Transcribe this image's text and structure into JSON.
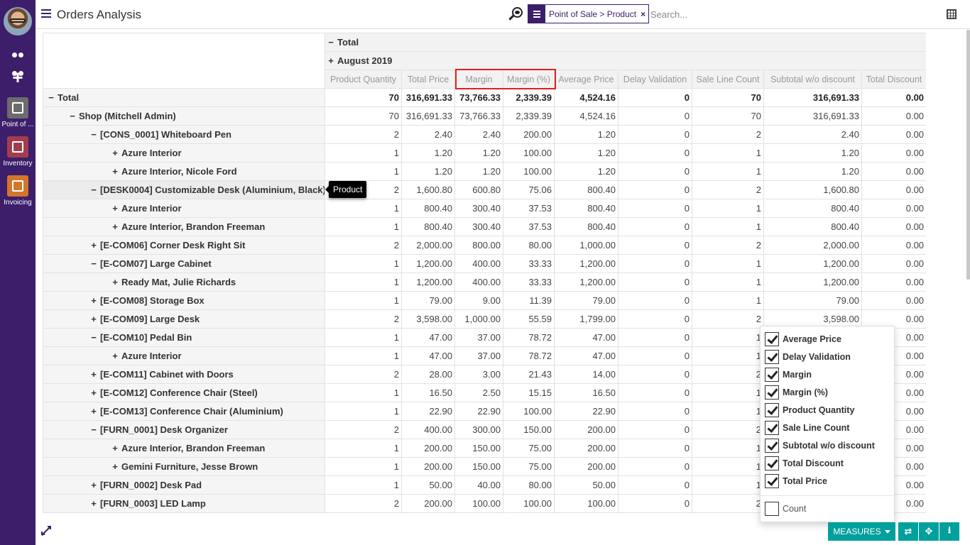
{
  "appbar": {
    "apps": [
      {
        "label": "Point of ...",
        "icon": "point-of-sale-icon"
      },
      {
        "label": "Inventory",
        "icon": "inventory-icon"
      },
      {
        "label": "Invoicing",
        "icon": "invoicing-icon"
      }
    ]
  },
  "header": {
    "title": "Orders Analysis",
    "facet": "Point of Sale > Product",
    "facet_remove": "×",
    "search_placeholder": "Search..."
  },
  "pivot": {
    "col_total": "Total",
    "col_group": "August 2019",
    "measures": [
      "Product Quantity",
      "Total Price",
      "Margin",
      "Margin (%)",
      "Average Price",
      "Delay Validation",
      "Sale Line Count",
      "Subtotal w/o discount",
      "Total Discount"
    ],
    "rows": [
      {
        "sign": "−",
        "level": 0,
        "label": "Total",
        "values": [
          "70",
          "316,691.33",
          "73,766.33",
          "2,339.39",
          "4,524.16",
          "0",
          "70",
          "316,691.33",
          "0.00"
        ]
      },
      {
        "sign": "−",
        "level": 1,
        "label": "Shop (Mitchell Admin)",
        "values": [
          "70",
          "316,691.33",
          "73,766.33",
          "2,339.39",
          "4,524.16",
          "0",
          "70",
          "316,691.33",
          "0.00"
        ]
      },
      {
        "sign": "−",
        "level": 2,
        "label": "[CONS_0001] Whiteboard Pen",
        "values": [
          "2",
          "2.40",
          "2.40",
          "200.00",
          "1.20",
          "0",
          "2",
          "2.40",
          "0.00"
        ]
      },
      {
        "sign": "+",
        "level": 3,
        "label": "Azure Interior",
        "values": [
          "1",
          "1.20",
          "1.20",
          "100.00",
          "1.20",
          "0",
          "1",
          "1.20",
          "0.00"
        ]
      },
      {
        "sign": "+",
        "level": 3,
        "label": "Azure Interior, Nicole Ford",
        "values": [
          "1",
          "1.20",
          "1.20",
          "100.00",
          "1.20",
          "0",
          "1",
          "1.20",
          "0.00"
        ]
      },
      {
        "sign": "−",
        "level": 2,
        "label": "[DESK0004] Customizable Desk (Aluminium, Black)",
        "values": [
          "2",
          "1,600.80",
          "600.80",
          "75.06",
          "800.40",
          "0",
          "2",
          "1,600.80",
          "0.00"
        ]
      },
      {
        "sign": "+",
        "level": 3,
        "label": "Azure Interior",
        "values": [
          "1",
          "800.40",
          "300.40",
          "37.53",
          "800.40",
          "0",
          "1",
          "800.40",
          "0.00"
        ]
      },
      {
        "sign": "+",
        "level": 3,
        "label": "Azure Interior, Brandon Freeman",
        "values": [
          "1",
          "800.40",
          "300.40",
          "37.53",
          "800.40",
          "0",
          "1",
          "800.40",
          "0.00"
        ]
      },
      {
        "sign": "+",
        "level": 2,
        "label": "[E-COM06] Corner Desk Right Sit",
        "values": [
          "2",
          "2,000.00",
          "800.00",
          "80.00",
          "1,000.00",
          "0",
          "2",
          "2,000.00",
          "0.00"
        ]
      },
      {
        "sign": "−",
        "level": 2,
        "label": "[E-COM07] Large Cabinet",
        "values": [
          "1",
          "1,200.00",
          "400.00",
          "33.33",
          "1,200.00",
          "0",
          "1",
          "1,200.00",
          "0.00"
        ]
      },
      {
        "sign": "+",
        "level": 3,
        "label": "Ready Mat, Julie Richards",
        "values": [
          "1",
          "1,200.00",
          "400.00",
          "33.33",
          "1,200.00",
          "0",
          "1",
          "1,200.00",
          "0.00"
        ]
      },
      {
        "sign": "+",
        "level": 2,
        "label": "[E-COM08] Storage Box",
        "values": [
          "1",
          "79.00",
          "9.00",
          "11.39",
          "79.00",
          "0",
          "1",
          "79.00",
          "0.00"
        ]
      },
      {
        "sign": "+",
        "level": 2,
        "label": "[E-COM09] Large Desk",
        "values": [
          "2",
          "3,598.00",
          "1,000.00",
          "55.59",
          "1,799.00",
          "0",
          "2",
          "3,598.00",
          "0.00"
        ]
      },
      {
        "sign": "−",
        "level": 2,
        "label": "[E-COM10] Pedal Bin",
        "values": [
          "1",
          "47.00",
          "37.00",
          "78.72",
          "47.00",
          "0",
          "1",
          "",
          "0.00"
        ]
      },
      {
        "sign": "+",
        "level": 3,
        "label": "Azure Interior",
        "values": [
          "1",
          "47.00",
          "37.00",
          "78.72",
          "47.00",
          "0",
          "1",
          "",
          "0.00"
        ]
      },
      {
        "sign": "+",
        "level": 2,
        "label": "[E-COM11] Cabinet with Doors",
        "values": [
          "2",
          "28.00",
          "3.00",
          "21.43",
          "14.00",
          "0",
          "2",
          "",
          "0.00"
        ]
      },
      {
        "sign": "+",
        "level": 2,
        "label": "[E-COM12] Conference Chair (Steel)",
        "values": [
          "1",
          "16.50",
          "2.50",
          "15.15",
          "16.50",
          "0",
          "1",
          "",
          "0.00"
        ]
      },
      {
        "sign": "+",
        "level": 2,
        "label": "[E-COM13] Conference Chair (Aluminium)",
        "values": [
          "1",
          "22.90",
          "22.90",
          "100.00",
          "22.90",
          "0",
          "1",
          "",
          "0.00"
        ]
      },
      {
        "sign": "−",
        "level": 2,
        "label": "[FURN_0001] Desk Organizer",
        "values": [
          "2",
          "400.00",
          "300.00",
          "150.00",
          "200.00",
          "0",
          "2",
          "",
          "0.00"
        ]
      },
      {
        "sign": "+",
        "level": 3,
        "label": "Azure Interior, Brandon Freeman",
        "values": [
          "1",
          "200.00",
          "150.00",
          "75.00",
          "200.00",
          "0",
          "1",
          "",
          "0.00"
        ]
      },
      {
        "sign": "+",
        "level": 3,
        "label": "Gemini Furniture, Jesse Brown",
        "values": [
          "1",
          "200.00",
          "150.00",
          "75.00",
          "200.00",
          "0",
          "1",
          "",
          "0.00"
        ]
      },
      {
        "sign": "+",
        "level": 2,
        "label": "[FURN_0002] Desk Pad",
        "values": [
          "1",
          "50.00",
          "40.00",
          "80.00",
          "50.00",
          "0",
          "1",
          "",
          "0.00"
        ]
      },
      {
        "sign": "+",
        "level": 2,
        "label": "[FURN_0003] LED Lamp",
        "values": [
          "2",
          "200.00",
          "100.00",
          "100.00",
          "100.00",
          "0",
          "2",
          "",
          "0.00"
        ]
      }
    ]
  },
  "tooltip": "Product",
  "measures_menu": {
    "items": [
      {
        "label": "Average Price",
        "checked": true
      },
      {
        "label": "Delay Validation",
        "checked": true
      },
      {
        "label": "Margin",
        "checked": true
      },
      {
        "label": "Margin (%)",
        "checked": true
      },
      {
        "label": "Product Quantity",
        "checked": true
      },
      {
        "label": "Sale Line Count",
        "checked": true
      },
      {
        "label": "Subtotal w/o discount",
        "checked": true
      },
      {
        "label": "Total Discount",
        "checked": true
      },
      {
        "label": "Total Price",
        "checked": true
      }
    ],
    "count_label": "Count",
    "count_checked": false
  },
  "bottom": {
    "measures_label": "MEASURES",
    "flip_icon": "flip-axis-icon",
    "expand_icon": "expand-all-icon",
    "download_icon": "download-icon"
  },
  "colors": {
    "brand": "#3c1e6b",
    "button": "#00a09d",
    "highlight": "#e02020"
  }
}
